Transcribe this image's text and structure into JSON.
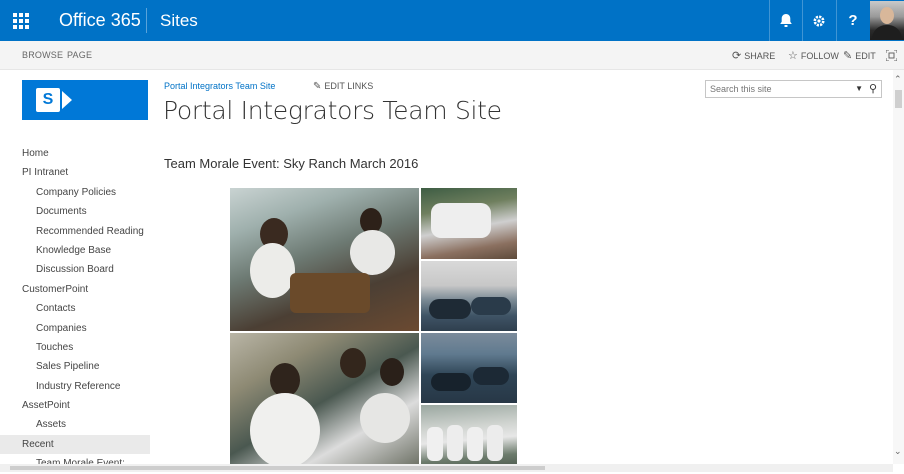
{
  "suite_bar": {
    "app_name": "Office 365",
    "section": "Sites",
    "notification_icon": "bell-icon",
    "settings_icon": "gear-icon",
    "help_label": "?",
    "accent_color": "#0072c6"
  },
  "ribbon": {
    "tabs": [
      "BROWSE",
      "PAGE"
    ],
    "actions": {
      "share": "SHARE",
      "follow": "FOLLOW",
      "edit": "EDIT"
    }
  },
  "header": {
    "site_link": "Portal Integrators Team Site",
    "edit_links": "EDIT LINKS",
    "site_title": "Portal Integrators Team Site"
  },
  "search": {
    "placeholder": "Search this site"
  },
  "nav": {
    "items": [
      {
        "label": "Home",
        "level": 0
      },
      {
        "label": "PI Intranet",
        "level": 0
      },
      {
        "label": "Company Policies",
        "level": 1
      },
      {
        "label": "Documents",
        "level": 1
      },
      {
        "label": "Recommended Reading",
        "level": 1
      },
      {
        "label": "Knowledge Base",
        "level": 1
      },
      {
        "label": "Discussion Board",
        "level": 1
      },
      {
        "label": "CustomerPoint",
        "level": 0
      },
      {
        "label": "Contacts",
        "level": 1
      },
      {
        "label": "Companies",
        "level": 1
      },
      {
        "label": "Touches",
        "level": 1
      },
      {
        "label": "Sales Pipeline",
        "level": 1
      },
      {
        "label": "Industry Reference",
        "level": 1
      },
      {
        "label": "AssetPoint",
        "level": 0
      },
      {
        "label": "Assets",
        "level": 1
      },
      {
        "label": "Recent",
        "level": 0,
        "selected": true
      },
      {
        "label": "Team Morale Event:",
        "level": 1
      }
    ]
  },
  "main": {
    "page_heading": "Team Morale Event: Sky Ranch March 2016"
  }
}
